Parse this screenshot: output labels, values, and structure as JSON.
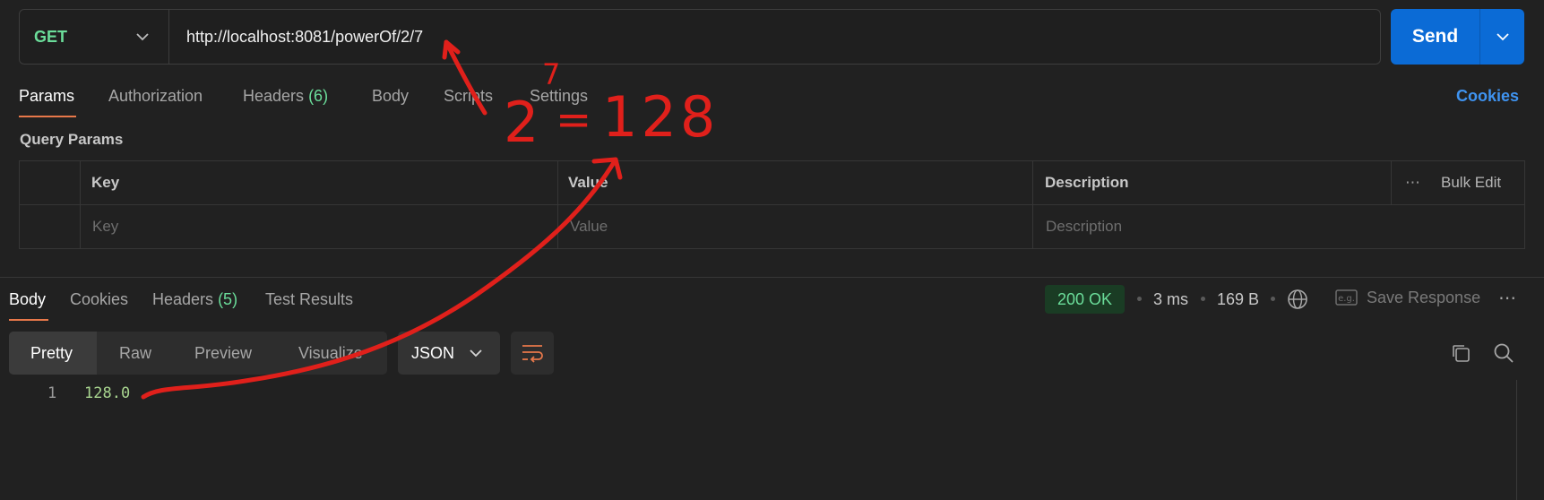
{
  "request": {
    "method": "GET",
    "url": "http://localhost:8081/powerOf/2/7",
    "send_label": "Send"
  },
  "request_tabs": [
    {
      "label": "Params",
      "active": true
    },
    {
      "label": "Authorization"
    },
    {
      "label": "Headers",
      "count": "(6)"
    },
    {
      "label": "Body"
    },
    {
      "label": "Scripts"
    },
    {
      "label": "Settings"
    }
  ],
  "cookies_label": "Cookies",
  "query_params": {
    "title": "Query Params",
    "columns": [
      "Key",
      "Value",
      "Description"
    ],
    "bulk_edit": "Bulk Edit",
    "placeholders": {
      "key": "Key",
      "value": "Value",
      "description": "Description"
    }
  },
  "response": {
    "tabs": [
      {
        "label": "Body",
        "active": true
      },
      {
        "label": "Cookies"
      },
      {
        "label": "Headers",
        "count": "(5)"
      },
      {
        "label": "Test Results"
      }
    ],
    "status": "200 OK",
    "time": "3 ms",
    "size": "169 B",
    "save_label": "Save Response",
    "view_modes": [
      "Pretty",
      "Raw",
      "Preview",
      "Visualize"
    ],
    "active_view": "Pretty",
    "format": "JSON",
    "lines": [
      {
        "number": "1",
        "text": "128.0"
      }
    ]
  },
  "annotation": {
    "base": "2",
    "exponent": "7",
    "equals": "=",
    "result": "128",
    "color": "#e0201b"
  },
  "colors": {
    "accent": "#0b6bd6",
    "method_green": "#6bdd9a",
    "tab_underline": "#e8784a",
    "link_blue": "#3f93f0"
  }
}
